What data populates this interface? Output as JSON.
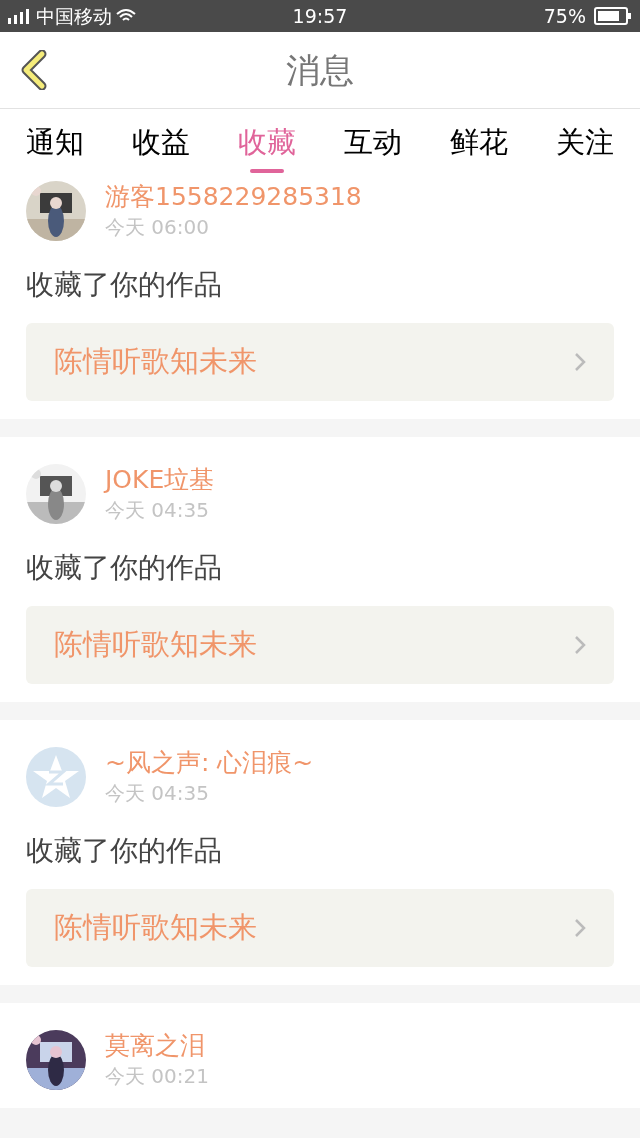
{
  "status_bar": {
    "carrier": "中国移动",
    "time": "19:57",
    "battery": "75%"
  },
  "header": {
    "title": "消息"
  },
  "tabs": [
    {
      "label": "通知",
      "selected": false
    },
    {
      "label": "收益",
      "selected": false
    },
    {
      "label": "收藏",
      "selected": true
    },
    {
      "label": "互动",
      "selected": false
    },
    {
      "label": "鲜花",
      "selected": false
    },
    {
      "label": "关注",
      "selected": false
    }
  ],
  "messages": [
    {
      "name": "游客1558229285318",
      "time": "今天 06:00",
      "text": "收藏了你的作品",
      "work": "陈情听歌知未来"
    },
    {
      "name": "JOKE垃基",
      "time": "今天 04:35",
      "text": "收藏了你的作品",
      "work": "陈情听歌知未来"
    },
    {
      "avatar": {
        "kind": "default"
      },
      "name": "~风之声: 心泪痕~",
      "time": "今天 04:35",
      "text": "收藏了你的作品",
      "work": "陈情听歌知未来"
    },
    {
      "name": "莫离之泪",
      "time": "今天 00:21"
    }
  ]
}
